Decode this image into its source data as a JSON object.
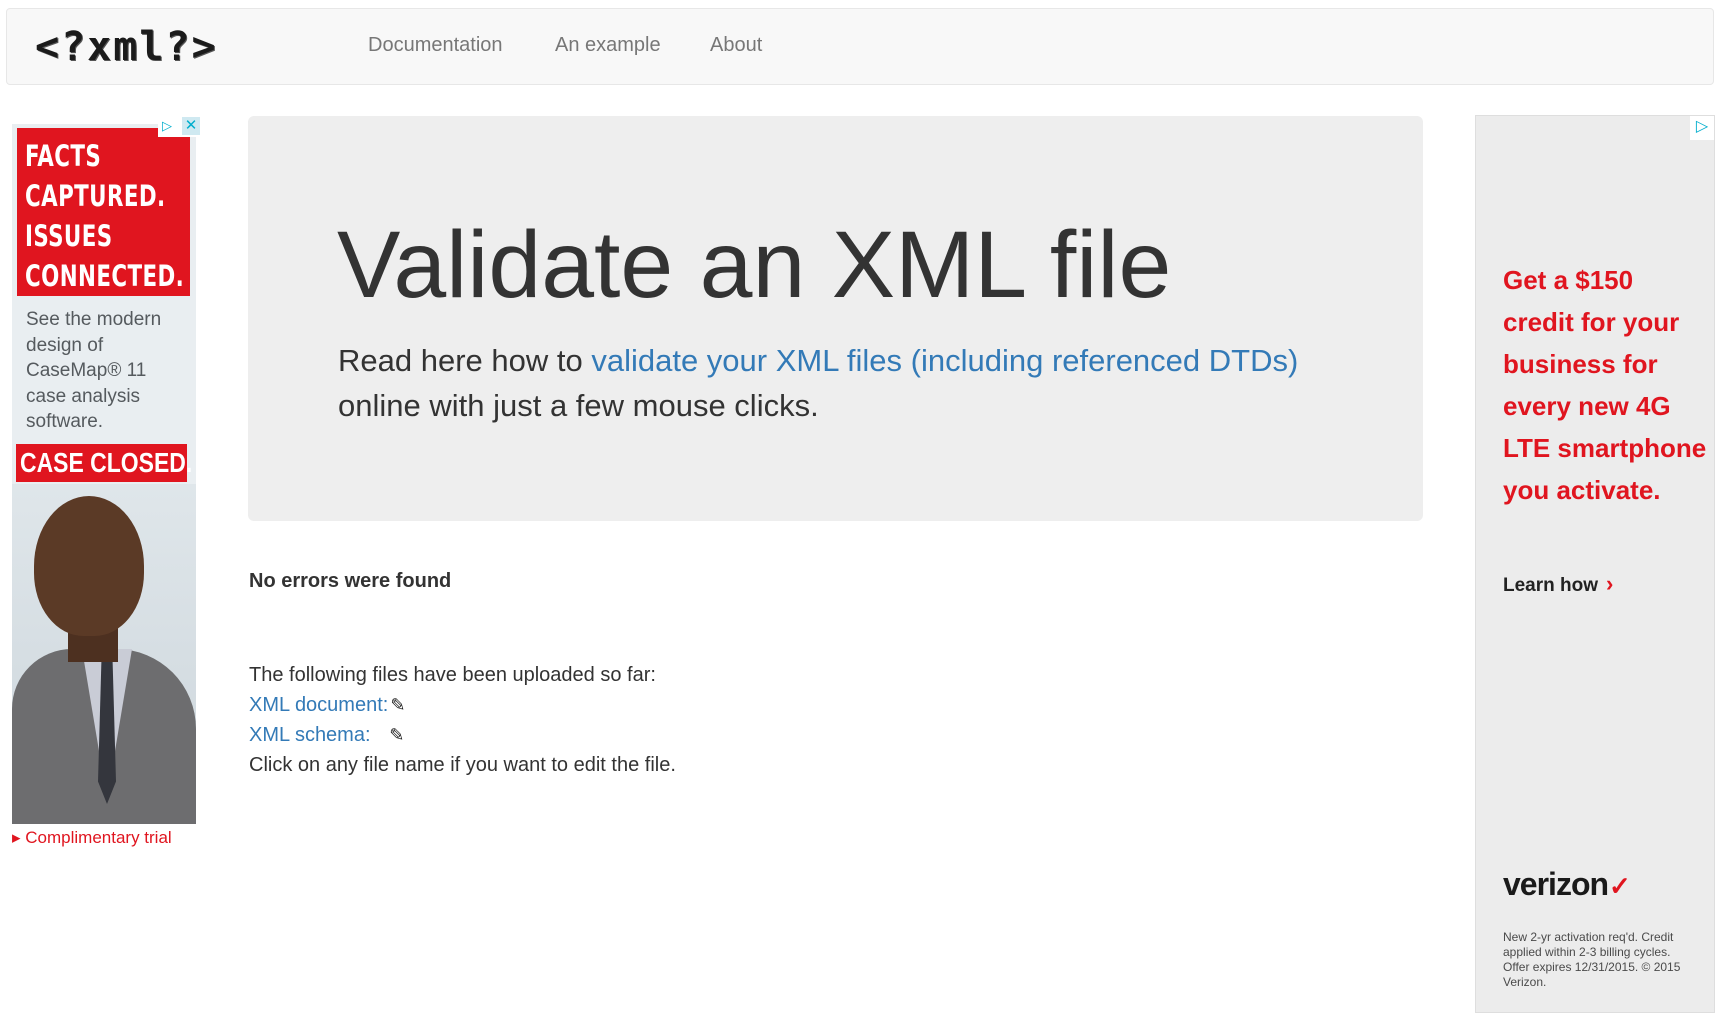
{
  "navbar": {
    "brand": "<?xml?>",
    "links": [
      "Documentation",
      "An example",
      "About"
    ]
  },
  "ad_left": {
    "headline": [
      "FACTS",
      "CAPTURED.",
      "ISSUES",
      "CONNECTED."
    ],
    "body": "See the modern design of CaseMap® 11 case analysis software.",
    "banner": "CASE CLOSED.",
    "cta": "▸ Complimentary trial",
    "adchoices_icon": "adchoices-icon",
    "close_icon": "close-icon"
  },
  "jumbotron": {
    "title": "Validate an XML file",
    "lead_before": "Read here how to ",
    "lead_link": "validate your XML files (including referenced DTDs)",
    "lead_after": " online with just a few mouse clicks."
  },
  "result": {
    "status": "No errors were found"
  },
  "files": {
    "intro": "The following files have been uploaded so far:",
    "xml_document": "XML document:",
    "xml_schema": "XML schema:",
    "edit_icon": "pencil-icon",
    "hint": "Click on any file name if you want to edit the file."
  },
  "ad_right": {
    "offer": "Get a $150 credit for your business for every new 4G LTE smartphone you activate.",
    "cta": "Learn how",
    "brand": "verizon",
    "legal": "New 2-yr activation req'd. Credit applied within 2-3 billing cycles. Offer expires 12/31/2015. © 2015 Verizon."
  },
  "colors": {
    "link": "#337ab7",
    "nav_text": "#777777",
    "jumbotron_bg": "#eeeeee",
    "ad_red": "#e0151f"
  }
}
